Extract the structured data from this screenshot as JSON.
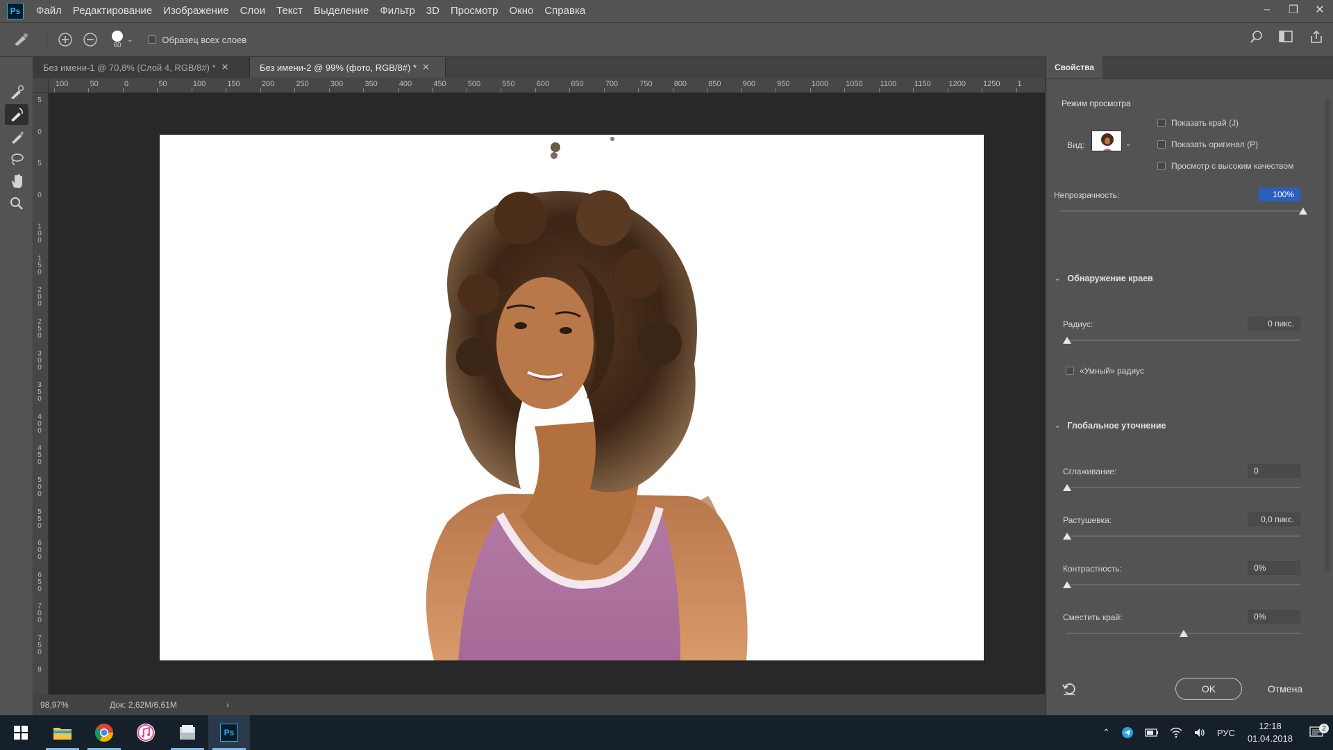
{
  "app": {
    "logo": "Ps"
  },
  "menu": [
    "Файл",
    "Редактирование",
    "Изображение",
    "Слои",
    "Текст",
    "Выделение",
    "Фильтр",
    "3D",
    "Просмотр",
    "Окно",
    "Справка"
  ],
  "window_controls": {
    "minimize": "–",
    "restore": "❐",
    "close": "✕"
  },
  "options": {
    "brush_size": "60",
    "sample_all_layers_label": "Образец всех слоев",
    "sample_all_layers_checked": false
  },
  "tools": [
    "quick-selection-brush",
    "refine-edge-brush",
    "brush",
    "lasso",
    "hand",
    "zoom"
  ],
  "tabs": [
    {
      "label": "Без имени-1 @ 70,8% (Слой 4, RGB/8#) *",
      "close": "✕",
      "active": false
    },
    {
      "label": "Без имени-2 @ 99% (фото, RGB/8#) *",
      "close": "✕",
      "active": true
    }
  ],
  "ruler_top": [
    "100",
    "50",
    "0",
    "50",
    "100",
    "150",
    "200",
    "250",
    "300",
    "350",
    "400",
    "450",
    "500",
    "550",
    "600",
    "650",
    "700",
    "750",
    "800",
    "850",
    "900",
    "950",
    "1000",
    "1050",
    "1100",
    "1150",
    "1200",
    "1250",
    "1"
  ],
  "ruler_left": [
    "5",
    "0",
    "5",
    "0",
    "100",
    "150",
    "200",
    "250",
    "300",
    "350",
    "400",
    "450",
    "500",
    "550",
    "600",
    "650",
    "700",
    "750",
    "8"
  ],
  "status": {
    "zoom": "98,97%",
    "doc": "Док: 2,62M/6,61M",
    "arrow": "›"
  },
  "panel": {
    "tab_label": "Свойства",
    "view_mode_label": "Режим просмотра",
    "view_label": "Вид:",
    "show_edge": "Показать край (J)",
    "show_original": "Показать оригинал (P)",
    "high_quality": "Просмотр с высоким качеством",
    "opacity_label": "Непрозрачность:",
    "opacity_value": "100%",
    "opacity_level": 1.0,
    "edge_detection_label": "Обнаружение краев",
    "radius_label": "Радиус:",
    "radius_value": "0 пикс.",
    "radius_level": 0,
    "smart_radius": "«Умный» радиус",
    "global_refinement_label": "Глобальное уточнение",
    "smooth_label": "Сглаживание:",
    "smooth_value": "0",
    "smooth_level": 0,
    "feather_label": "Растушевка:",
    "feather_value": "0,0 пикс.",
    "feather_level": 0,
    "contrast_label": "Контрастность:",
    "contrast_value": "0%",
    "contrast_level": 0,
    "shift_edge_label": "Сместить край:",
    "shift_edge_value": "0%",
    "shift_edge_level": 0.5,
    "ok_label": "OK",
    "cancel_label": "Отмена"
  },
  "taskbar": {
    "apps": [
      "windows-start",
      "file-explorer",
      "chrome",
      "itunes",
      "files",
      "photoshop"
    ],
    "ps_label": "Ps",
    "lang": "РУС",
    "time": "12:18",
    "date": "01.04.2018",
    "notifications": "2"
  }
}
